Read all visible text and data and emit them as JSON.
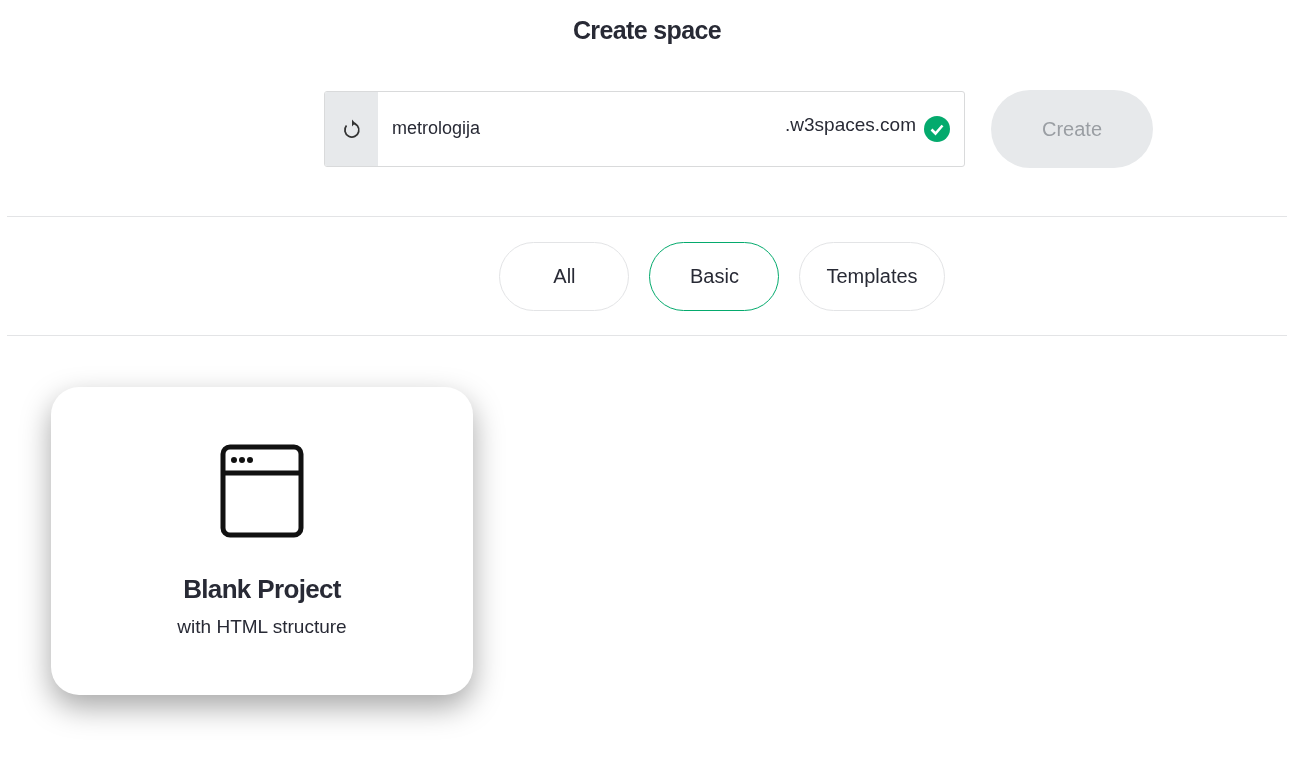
{
  "title": "Create space",
  "space": {
    "value": "metrologija",
    "suffix": ".w3spaces.com",
    "valid": true
  },
  "create_button": {
    "label": "Create",
    "disabled": true
  },
  "filters": [
    {
      "label": "All",
      "selected": false
    },
    {
      "label": "Basic",
      "selected": true
    },
    {
      "label": "Templates",
      "selected": false
    }
  ],
  "cards": [
    {
      "title": "Blank Project",
      "subtitle": "with HTML structure"
    }
  ]
}
